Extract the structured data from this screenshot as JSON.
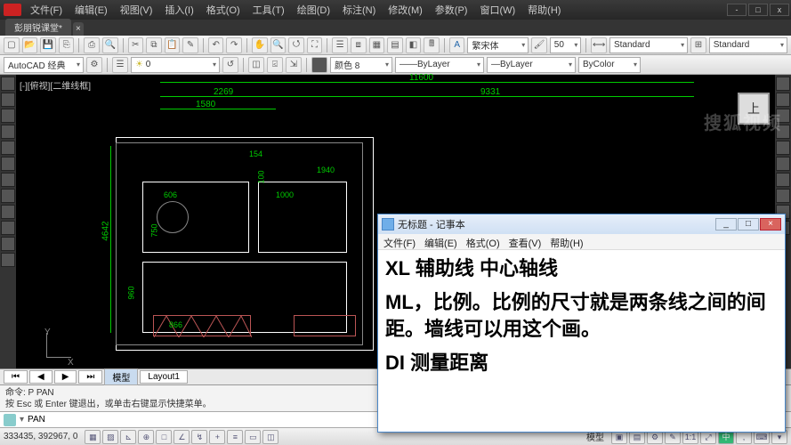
{
  "titlebar": {
    "menus": [
      "文件(F)",
      "编辑(E)",
      "视图(V)",
      "插入(I)",
      "格式(O)",
      "工具(T)",
      "绘图(D)",
      "标注(N)",
      "修改(M)",
      "参数(P)",
      "窗口(W)",
      "帮助(H)"
    ]
  },
  "doctab": {
    "name": "彭朋锐课堂*"
  },
  "toolbar2": {
    "workspace": "AutoCAD 经典",
    "layer": "0",
    "font": "繁宋体",
    "fsize": "50",
    "style1": "Standard",
    "style2": "Standard"
  },
  "toolbar3": {
    "color": "颜色 8",
    "lt": "ByLayer",
    "lw": "ByLayer",
    "ps": "ByColor"
  },
  "viewport": {
    "label": "[-][俯视][二维线框]",
    "cube": "上",
    "ucs_x": "X",
    "ucs_y": "Y"
  },
  "dims": {
    "top_total": "11600",
    "top_left": "2269",
    "top_right": "9331",
    "sub_left": "1580",
    "side_total": "4642",
    "inner_a": "606",
    "inner_b": "750",
    "inner_c": "960",
    "inner_d": "1000",
    "inner_e": "100",
    "inner_f": "866",
    "inner_g": "1940",
    "inner_h": "154"
  },
  "notepad": {
    "title": "无标题 - 记事本",
    "menus": [
      "文件(F)",
      "编辑(E)",
      "格式(O)",
      "查看(V)",
      "帮助(H)"
    ],
    "p1": "XL 辅助线  中心轴线",
    "p2": "ML，比例。比例的尺寸就是两条线之间的间距。墙线可以用这个画。",
    "p3": "DI 测量距离"
  },
  "modeltabs": {
    "a": "模型",
    "b": "Layout1"
  },
  "cmd": {
    "l1": "命令: P PAN",
    "l2": "按 Esc 或 Enter 键退出，或单击右键显示快捷菜单。",
    "prompt": "PAN"
  },
  "status": {
    "coord": "333435, 392967, 0",
    "right1": "模型",
    "ime": "中"
  },
  "watermark": "搜狐视频"
}
